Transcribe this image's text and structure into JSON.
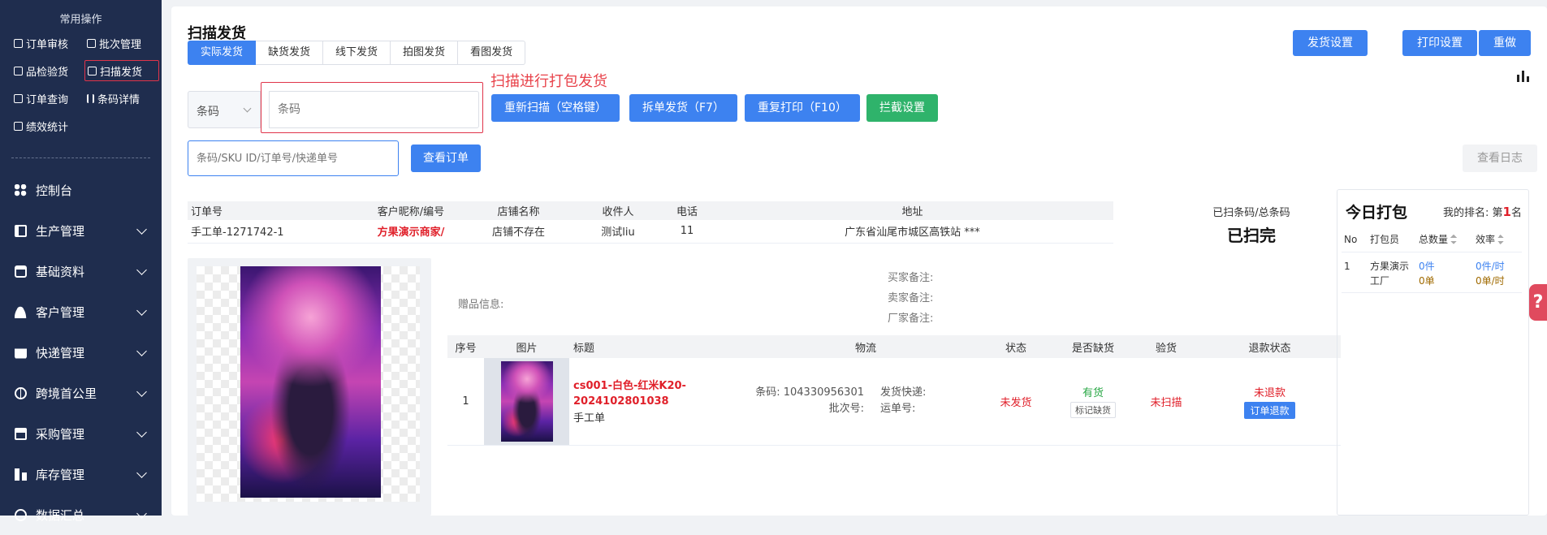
{
  "sidebar": {
    "title": "常用操作",
    "quick": [
      {
        "label": "订单审核"
      },
      {
        "label": "批次管理"
      },
      {
        "label": "品检验货"
      },
      {
        "label": "扫描发货"
      },
      {
        "label": "订单查询"
      },
      {
        "label": "条码详情"
      },
      {
        "label": "绩效统计"
      }
    ],
    "nav": [
      {
        "label": "控制台",
        "icon": "dashboard-icon"
      },
      {
        "label": "生产管理",
        "icon": "production-icon"
      },
      {
        "label": "基础资料",
        "icon": "basic-data-icon"
      },
      {
        "label": "客户管理",
        "icon": "customer-icon"
      },
      {
        "label": "快递管理",
        "icon": "express-icon"
      },
      {
        "label": "跨境首公里",
        "icon": "cross-border-icon"
      },
      {
        "label": "采购管理",
        "icon": "purchase-icon"
      },
      {
        "label": "库存管理",
        "icon": "inventory-icon"
      },
      {
        "label": "数据汇总",
        "icon": "data-summary-icon"
      }
    ]
  },
  "page": {
    "title": "扫描发货",
    "tabs": [
      {
        "label": "实际发货",
        "active": true
      },
      {
        "label": "缺货发货"
      },
      {
        "label": "线下发货"
      },
      {
        "label": "拍图发货"
      },
      {
        "label": "看图发货"
      }
    ],
    "top_buttons": {
      "ship_settings": "发货设置",
      "print_settings": "打印设置",
      "redo": "重做"
    },
    "annotation": "扫描进行打包发货",
    "barcode": {
      "select": "条码",
      "placeholder": "条码"
    },
    "actions": {
      "rescan": "重新扫描（空格键）",
      "split": "拆单发货（F7）",
      "reprint": "重复打印（F10）",
      "intercept": "拦截设置"
    },
    "search": {
      "placeholder": "条码/SKU ID/订单号/快递单号",
      "button": "查看订单"
    },
    "log_button": "查看日志",
    "order_table": {
      "headers": [
        "订单号",
        "客户昵称/编号",
        "店铺名称",
        "收件人",
        "电话",
        "地址"
      ],
      "row": {
        "order_no": "手工单-1271742-1",
        "customer": "方果演示商家/",
        "shop": "店铺不存在",
        "receiver": "测试liu",
        "phone": "11",
        "address": "广东省汕尾市城区高铁站 ***"
      }
    },
    "scan_stat": {
      "label": "已扫条码/总条码",
      "value": "已扫完"
    },
    "gift_label": "赠品信息:",
    "remarks": {
      "buyer": "买家备注:",
      "seller": "卖家备注:",
      "factory": "厂家备注:"
    },
    "goods_table": {
      "headers": [
        "序号",
        "图片",
        "标题",
        "物流",
        "状态",
        "是否缺货",
        "验货",
        "退款状态"
      ],
      "row": {
        "index": "1",
        "title": "cs001-白色-红米K20-2024102801038",
        "subtitle": "手工单",
        "barcode": "条码: 104330956301",
        "batch": "批次号:",
        "express": "发货快递:",
        "tracking": "运单号:",
        "status": "未发货",
        "stock": "有货",
        "stock_btn": "标记缺货",
        "inspect": "未扫描",
        "refund": "未退款",
        "refund_btn": "订单退款"
      }
    },
    "today": {
      "title": "今日打包",
      "rank_prefix": "我的排名: 第",
      "rank": "1",
      "rank_suffix": "名",
      "headers": [
        "No",
        "打包员",
        "总数量",
        "效率"
      ],
      "rows": [
        {
          "no": "1",
          "packer": "方果演示工厂",
          "qty1": "0件",
          "qty2": "0单",
          "eff1": "0件/时",
          "eff2": "0单/时"
        }
      ]
    },
    "help": "?"
  },
  "colors": {
    "sidebar_bg": "#1f2d4e",
    "primary": "#3d82f0",
    "success": "#2fb36b",
    "danger": "#e0202a",
    "highlight": "#e0344a"
  }
}
